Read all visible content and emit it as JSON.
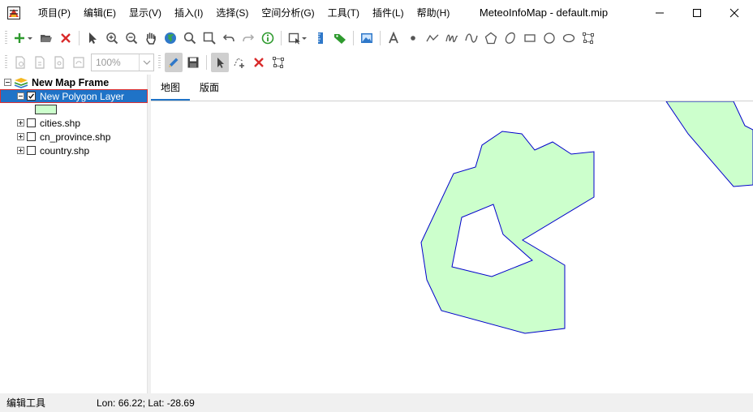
{
  "app": {
    "title": "MeteoInfoMap - default.mip"
  },
  "menu": {
    "items": [
      "项目(P)",
      "编辑(E)",
      "显示(V)",
      "插入(I)",
      "选择(S)",
      "空间分析(G)",
      "工具(T)",
      "插件(L)",
      "帮助(H)"
    ]
  },
  "window_controls": {
    "minimize": "–",
    "maximize": "☐",
    "close": "✕"
  },
  "toolbar2": {
    "zoom_value": "100%"
  },
  "tree": {
    "frame_label": "New Map Frame",
    "layers": [
      {
        "label": "New Polygon Layer",
        "checked": true,
        "selected": true
      },
      {
        "label": "cities.shp",
        "checked": false,
        "selected": false
      },
      {
        "label": "cn_province.shp",
        "checked": false,
        "selected": false
      },
      {
        "label": "country.shp",
        "checked": false,
        "selected": false
      }
    ],
    "legend_fill": "#ccffcc"
  },
  "tabs": [
    {
      "label": "地图",
      "active": true
    },
    {
      "label": "版面",
      "active": false
    }
  ],
  "map": {
    "polygon_fill": "#ccffcc",
    "polygon_stroke": "#0000cc"
  },
  "status": {
    "left": "编辑工具",
    "coords": "Lon: 66.22; Lat: -28.69"
  },
  "colors": {
    "accent": "#1f73c7",
    "selection_border": "#e03030"
  }
}
